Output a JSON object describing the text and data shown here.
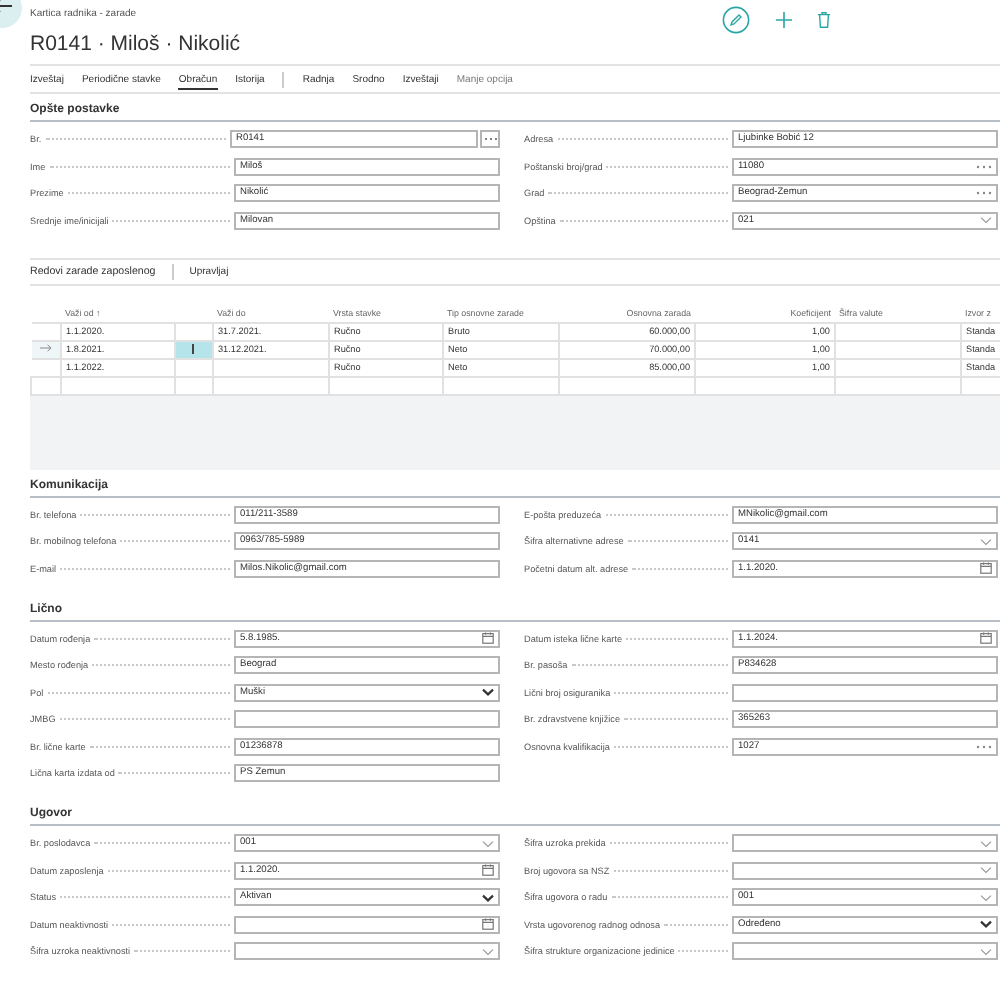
{
  "breadcrumb": "Kartica radnika - zarade",
  "title": "R0141 · Miloš · Nikolić",
  "actions": [
    {
      "label": "Izveštaj",
      "kind": "action",
      "selected": false
    },
    {
      "label": "Periodične stavke",
      "kind": "action",
      "selected": false
    },
    {
      "label": "Obračun",
      "kind": "action",
      "selected": true
    },
    {
      "label": "Istorija",
      "kind": "action",
      "selected": false
    },
    {
      "label": "Radnja",
      "kind": "group",
      "selected": false
    },
    {
      "label": "Srodno",
      "kind": "group",
      "selected": false
    },
    {
      "label": "Izveštaji",
      "kind": "group",
      "selected": false
    },
    {
      "label": "Manje opcija",
      "kind": "more",
      "selected": false
    }
  ],
  "general": {
    "title": "Opšte postavke",
    "left": [
      {
        "label": "Br.",
        "kind": "assist",
        "value": "R0141"
      },
      {
        "label": "Ime",
        "kind": "text",
        "value": "Miloš"
      },
      {
        "label": "Prezime",
        "kind": "text",
        "value": "Nikolić"
      },
      {
        "label": "Srednje ime/inicijali",
        "kind": "text",
        "value": "Milovan"
      }
    ],
    "right": [
      {
        "label": "Adresa",
        "kind": "text",
        "value": "Ljubinke Bobić 12"
      },
      {
        "label": "Poštanski broj/grad",
        "kind": "lookup",
        "value": "11080"
      },
      {
        "label": "Grad",
        "kind": "lookup",
        "value": "Beograd-Zemun"
      },
      {
        "label": "Opština",
        "kind": "dropdown",
        "value": "021"
      }
    ]
  },
  "lines": {
    "title": "Redovi zarade zaposlenog",
    "manage": "Upravljaj",
    "columns": [
      "Važi od ↑",
      "Važi do",
      "Vrsta stavke",
      "Tip osnovne zarade",
      "Osnovna zarada",
      "Koeficijent",
      "Šifra valute",
      "Izvor z"
    ],
    "rows": [
      {
        "selected": false,
        "cells": [
          "1.1.2020.",
          "31.7.2021.",
          "Ručno",
          "Bruto",
          "60.000,00",
          "1,00",
          null,
          "Standa"
        ]
      },
      {
        "selected": true,
        "cells": [
          "1.8.2021.",
          "31.12.2021.",
          "Ručno",
          "Neto",
          "70.000,00",
          "1,00",
          null,
          "Standa"
        ]
      },
      {
        "selected": false,
        "cells": [
          "1.1.2022.",
          null,
          "Ručno",
          "Neto",
          "85.000,00",
          "1,00",
          null,
          "Standa"
        ]
      }
    ]
  },
  "communication": {
    "title": "Komunikacija",
    "left": [
      {
        "label": "Br. telefona",
        "kind": "text",
        "value": "011/211-3589"
      },
      {
        "label": "Br. mobilnog telefona",
        "kind": "text",
        "value": "0963/785-5989"
      },
      {
        "label": "E-mail",
        "kind": "text",
        "value": "Milos.Nikolic@gmail.com"
      }
    ],
    "right": [
      {
        "label": "E-pošta preduzeća",
        "kind": "text",
        "value": "MNikolic@gmail.com"
      },
      {
        "label": "Šifra alternativne adrese",
        "kind": "dropdown",
        "value": "0141"
      },
      {
        "label": "Početni datum alt. adrese",
        "kind": "date",
        "value": "1.1.2020."
      }
    ]
  },
  "personal": {
    "title": "Lično",
    "left": [
      {
        "label": "Datum rođenja",
        "kind": "date",
        "value": "5.8.1985."
      },
      {
        "label": "Mesto rođenja",
        "kind": "text",
        "value": "Beograd"
      },
      {
        "label": "Pol",
        "kind": "option",
        "value": "Muški"
      },
      {
        "label": "JMBG",
        "kind": "text"
      },
      {
        "label": "Br. lične karte",
        "kind": "text",
        "value": "01236878"
      },
      {
        "label": "Lična karta izdata od",
        "kind": "text",
        "value": "PS Zemun"
      }
    ],
    "right": [
      {
        "label": "Datum isteka lične karte",
        "kind": "date",
        "value": "1.1.2024."
      },
      {
        "label": "Br. pasoša",
        "kind": "text",
        "value": "P834628"
      },
      {
        "label": "Lični broj osiguranika",
        "kind": "text"
      },
      {
        "label": "Br. zdravstvene knjižice",
        "kind": "text",
        "value": "365263"
      },
      {
        "label": "Osnovna kvalifikacija",
        "kind": "lookup",
        "value": "1027"
      }
    ]
  },
  "contract": {
    "title": "Ugovor",
    "left": [
      {
        "label": "Br. poslodavca",
        "kind": "dropdown",
        "value": "001"
      },
      {
        "label": "Datum zaposlenja",
        "kind": "date",
        "value": "1.1.2020."
      },
      {
        "label": "Status",
        "kind": "option",
        "value": "Aktivan"
      },
      {
        "label": "Datum neaktivnosti",
        "kind": "date"
      },
      {
        "label": "Šifra uzroka neaktivnosti",
        "kind": "dropdown"
      }
    ],
    "right": [
      {
        "label": "Šifra uzroka prekida",
        "kind": "dropdown"
      },
      {
        "label": "Broj ugovora sa NSZ",
        "kind": "dropdown"
      },
      {
        "label": "Šifra ugovora o radu",
        "kind": "dropdown",
        "value": "001"
      },
      {
        "label": "Vrsta ugovorenog radnog odnosa",
        "kind": "option",
        "value": "Određeno"
      },
      {
        "label": "Šifra strukture organizacione jedinice",
        "kind": "dropdown"
      }
    ]
  }
}
